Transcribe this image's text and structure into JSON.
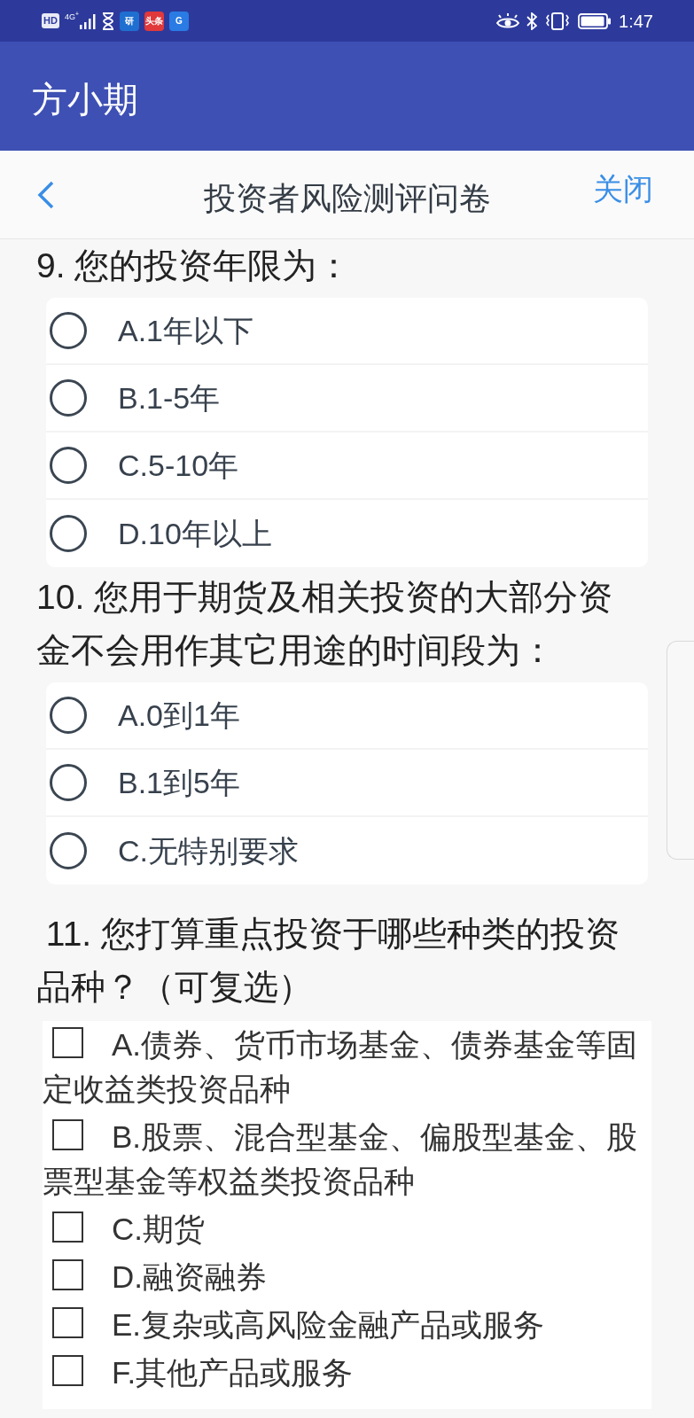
{
  "status_bar": {
    "badge": "HD",
    "network": "4G$^{+}$",
    "notifications": [
      {
        "kind": "timer"
      },
      {
        "kind": "tile",
        "label": "研",
        "color": "#1f6fd1"
      },
      {
        "kind": "tile",
        "label": "头条",
        "color": "#e0383b"
      },
      {
        "kind": "tile",
        "label": "G",
        "color": "#2a7be4"
      }
    ],
    "time": "1:47"
  },
  "app_bar": {
    "title": "方小期"
  },
  "nav": {
    "title": "投资者风险测评问卷",
    "close": "关闭"
  },
  "questions": [
    {
      "kind": "single",
      "text": "9. 您的投资年限为：",
      "options": [
        {
          "label": "A.1年以下",
          "selected": false
        },
        {
          "label": "B.1-5年",
          "selected": false
        },
        {
          "label": "C.5-10年",
          "selected": false
        },
        {
          "label": "D.10年以上",
          "selected": false
        }
      ]
    },
    {
      "kind": "single",
      "text": "10. 您用于期货及相关投资的大部分资金不会用作其它用途的时间段为：",
      "options": [
        {
          "label": "A.0到1年",
          "selected": false
        },
        {
          "label": "B.1到5年",
          "selected": false
        },
        {
          "label": "C.无特别要求",
          "selected": false
        }
      ]
    },
    {
      "kind": "multiple",
      "text": " 11. 您打算重点投资于哪些种类的投资品种？（可复选）",
      "options": [
        {
          "label": "A.债券、货币市场基金、债券基金等固定收益类投资品种",
          "checked": false
        },
        {
          "label": "B.股票、混合型基金、偏股型基金、股票型基金等权益类投资品种",
          "checked": false
        },
        {
          "label": "C.期货",
          "checked": false
        },
        {
          "label": "D.融资融券",
          "checked": false
        },
        {
          "label": "E.复杂或高风险金融产品或服务",
          "checked": false
        },
        {
          "label": "F.其他产品或服务",
          "checked": false
        }
      ]
    }
  ]
}
